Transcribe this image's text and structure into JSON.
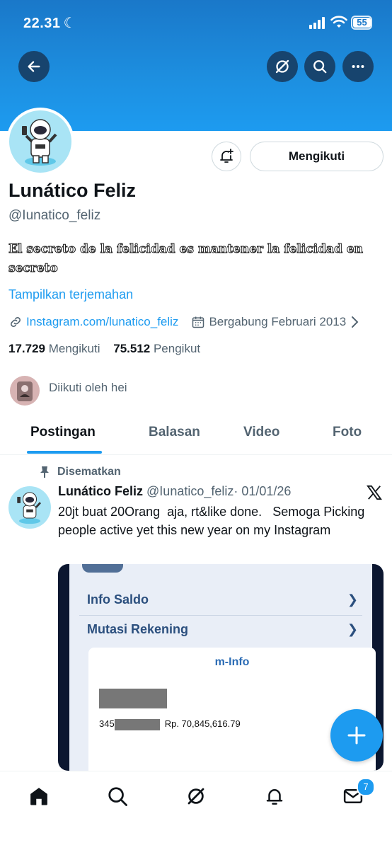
{
  "status_bar": {
    "time": "22.31",
    "battery": "55"
  },
  "profile": {
    "name": "Lunático Feliz",
    "handle": "@Iunatico_feliz",
    "bio": "El secreto de la felicidad es mantener la felicidad en secreto",
    "translate_label": "Tampilkan terjemahan",
    "link": "Instagram.com/lunatico_feliz",
    "joined": "Bergabung Februari 2013",
    "following_count": "17.729",
    "following_label": "Mengikuti",
    "followers_count": "75.512",
    "followers_label": "Pengikut",
    "followed_by": "Diikuti oleh hei",
    "follow_button": "Mengikuti"
  },
  "tabs": [
    {
      "label": "Postingan",
      "active": true
    },
    {
      "label": "Balasan"
    },
    {
      "label": "Video"
    },
    {
      "label": "Foto"
    }
  ],
  "pinned_post": {
    "pinned_label": "Disematkan",
    "author_name": "Lunático Feliz",
    "author_handle": "@Iunatico_feliz",
    "date": "· 01/01/26",
    "text": "20jt buat 20Orang  aja, rt&like done.   Semoga Picking people active yet this new year on my Instagram",
    "media": {
      "row1": "Info Saldo",
      "row2": "Mutasi Rekening",
      "card_title": "m-Info",
      "account_prefix": "345",
      "amount": "Rp.  70,845,616.79"
    }
  },
  "bottom_nav": {
    "messages_badge": "7"
  },
  "colors": {
    "accent": "#1d9bf0",
    "banner": "#1d8fe0",
    "text": "#0f1419",
    "muted": "#536471"
  },
  "icons": [
    "back-arrow-icon",
    "grok-icon",
    "search-icon",
    "more-icon",
    "bell-plus-icon",
    "link-icon",
    "calendar-icon",
    "chevron-right-icon",
    "pin-icon",
    "x-logo-icon",
    "plus-icon",
    "home-icon",
    "bell-icon",
    "mail-icon"
  ]
}
